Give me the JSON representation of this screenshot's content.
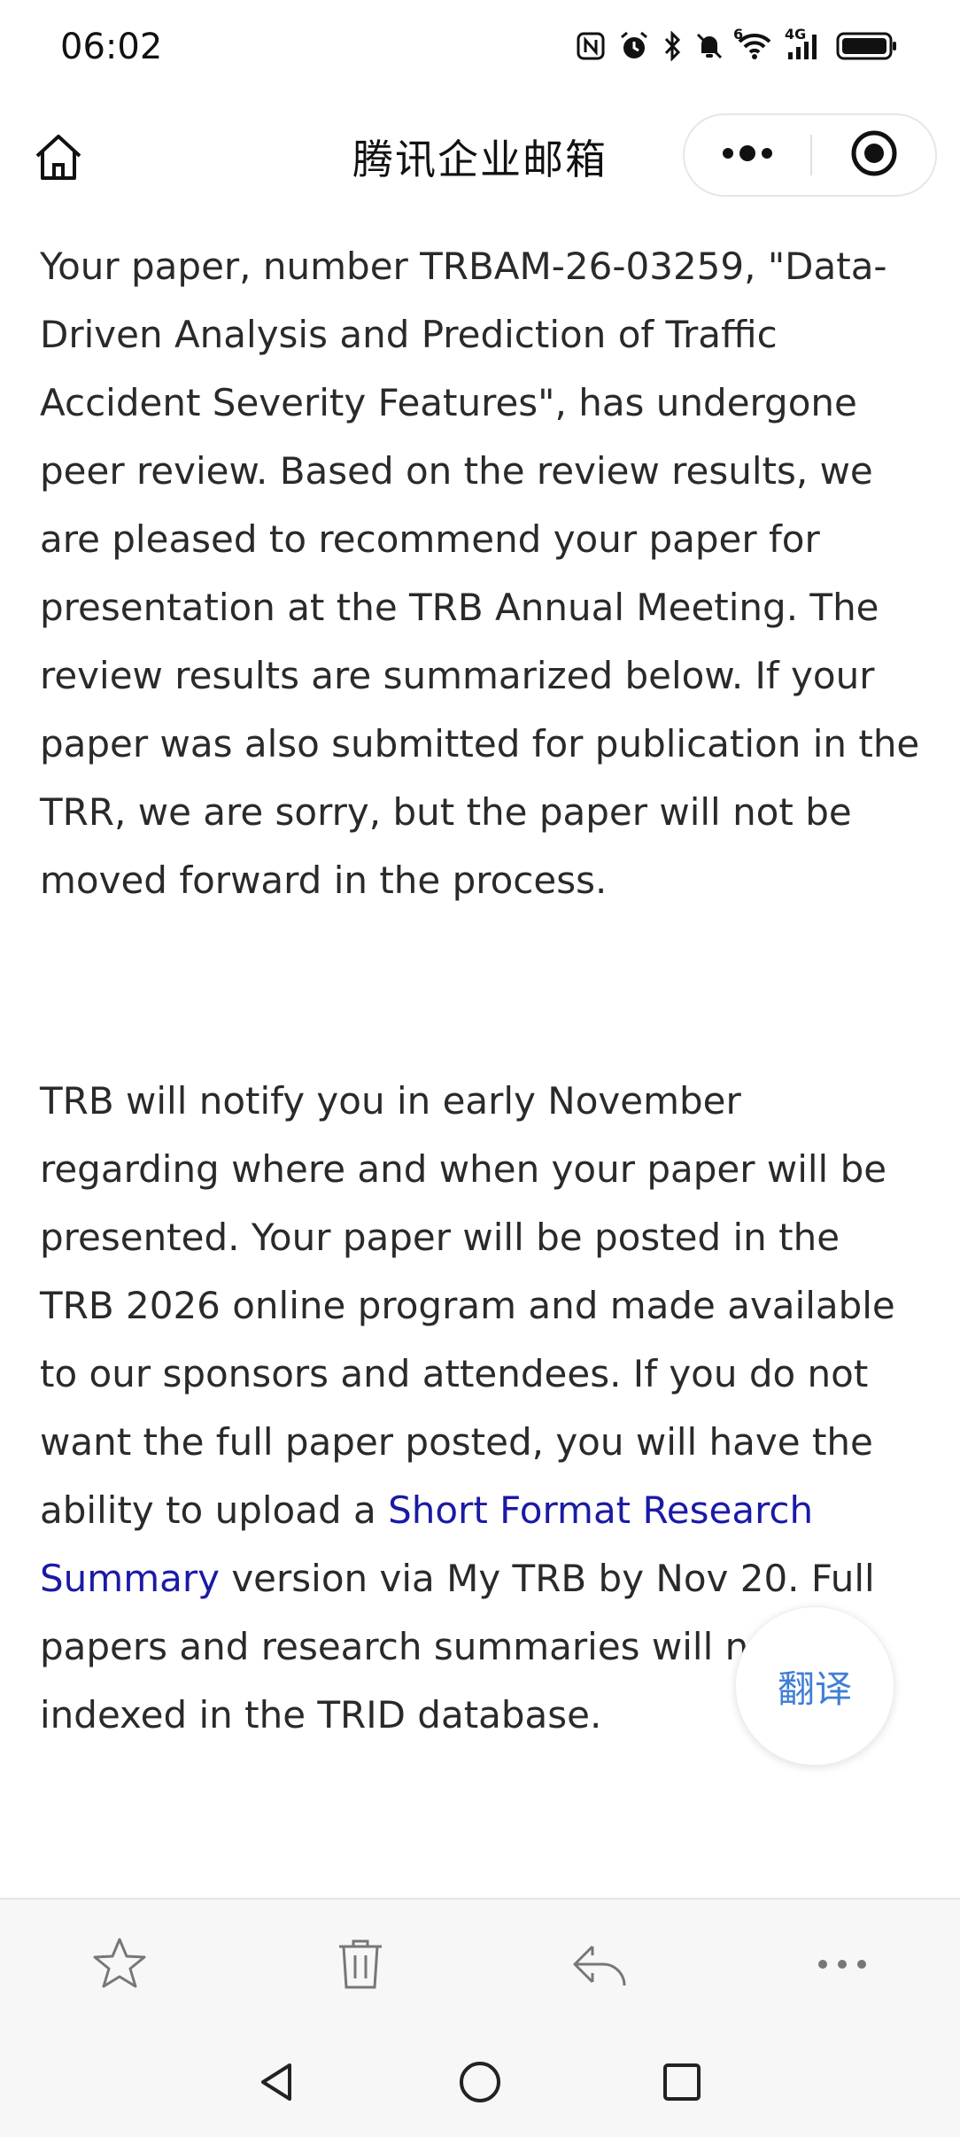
{
  "status_bar": {
    "time": "06:02",
    "network": "4G",
    "wifi_sub": "6"
  },
  "header": {
    "title": "腾讯企业邮箱"
  },
  "email": {
    "paragraph1": "Your paper, number TRBAM-26-03259, \"Data-Driven Analysis and Prediction of Traffic Accident Severity Features\", has undergone peer review. Based on the review results, we are pleased to recommend your paper for presentation at the TRB Annual Meeting. The review results are summarized below. If your paper was also submitted for publication in the TRR, we are sorry, but the paper will not be moved forward in the process.",
    "paragraph2_before": "TRB will notify you in early November regarding where and when your paper will be presented. Your paper will be posted in the TRB 2026 online program and made available to our sponsors and attendees. If you do not want the full paper posted, you will have the ability to upload a ",
    "paragraph2_link": "Short Format Research Summary",
    "paragraph2_after": " version via My TRB by Nov 20. Full papers and research summaries will not be indexed in the TRID database."
  },
  "translate_button": {
    "label": "翻译"
  },
  "colors": {
    "link": "#1a1aa6",
    "translate": "#3f7fd6",
    "toolbar_bg": "#f7f7f7"
  },
  "icons": {
    "header": [
      "home-icon",
      "more-dots-icon",
      "close-target-icon"
    ],
    "toolbar": [
      "star-icon",
      "trash-icon",
      "reply-icon",
      "more-horizontal-icon"
    ],
    "navbar": [
      "back-triangle-icon",
      "home-circle-icon",
      "recents-square-icon"
    ]
  }
}
